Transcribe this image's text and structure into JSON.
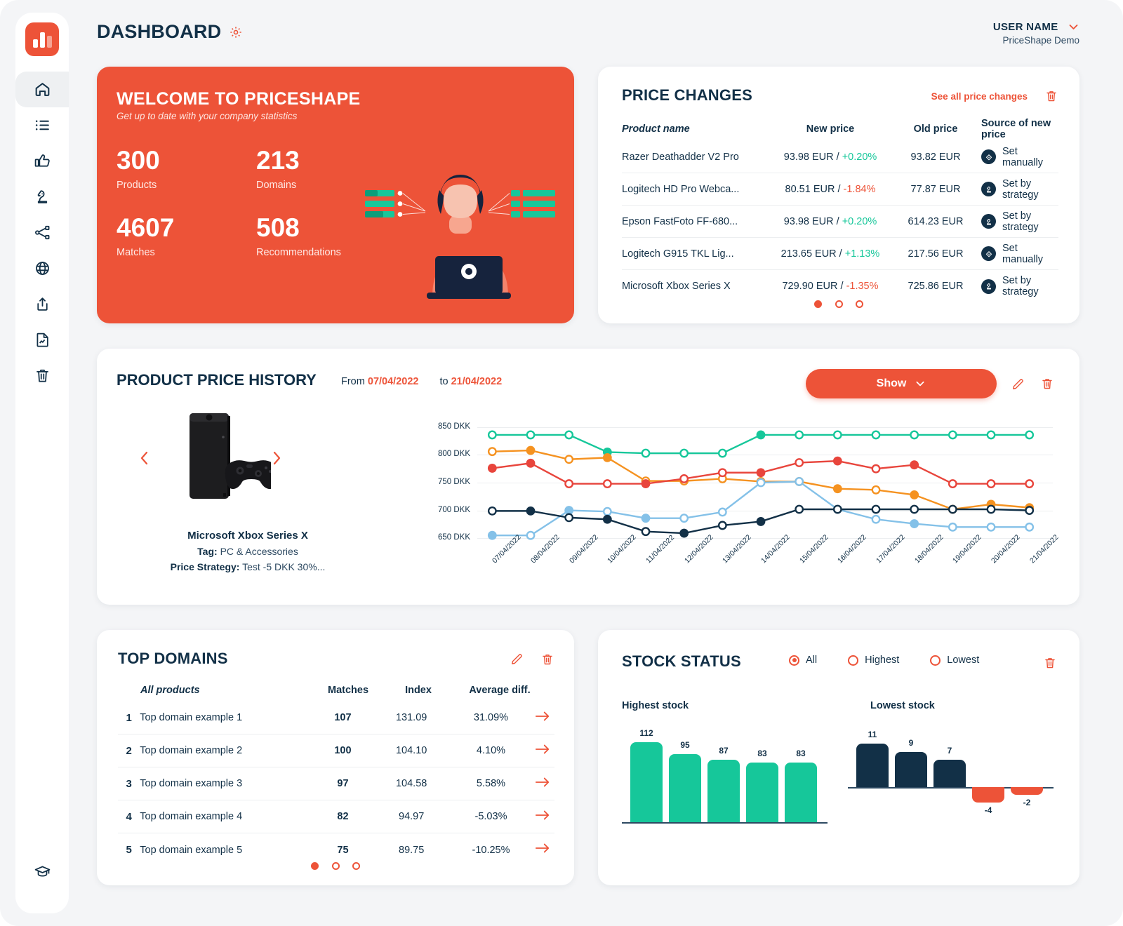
{
  "app": {
    "logo_icon": "bar-chart-logo",
    "page_title": "DASHBOARD",
    "settings_icon": "gear-icon"
  },
  "user": {
    "name": "USER NAME",
    "account": "PriceShape Demo",
    "caret_icon": "chevron-down-icon"
  },
  "sidebar": {
    "items": [
      {
        "name": "home",
        "icon": "home-icon",
        "active": true
      },
      {
        "name": "list",
        "icon": "list-icon",
        "active": false
      },
      {
        "name": "recommendations",
        "icon": "thumbs-up-icon",
        "active": false
      },
      {
        "name": "strategy",
        "icon": "chess-knight-icon",
        "active": false
      },
      {
        "name": "matches",
        "icon": "share-nodes-icon",
        "active": false
      },
      {
        "name": "domains",
        "icon": "globe-icon",
        "active": false
      },
      {
        "name": "export",
        "icon": "upload-box-icon",
        "active": false
      },
      {
        "name": "reports",
        "icon": "file-chart-icon",
        "active": false
      },
      {
        "name": "trash",
        "icon": "trash-icon",
        "active": false
      }
    ],
    "bottom_item": {
      "name": "academy",
      "icon": "graduation-cap-icon"
    }
  },
  "welcome": {
    "title": "WELCOME TO PRICESHAPE",
    "subtitle": "Get up to date with your company statistics",
    "stats": [
      {
        "value": "300",
        "label": "Products"
      },
      {
        "value": "213",
        "label": "Domains"
      },
      {
        "value": "4607",
        "label": "Matches"
      },
      {
        "value": "508",
        "label": "Recommendations"
      }
    ]
  },
  "price_changes": {
    "title": "PRICE CHANGES",
    "see_all_label": "See all price changes",
    "delete_icon": "trash-icon",
    "columns": [
      "Product name",
      "New price",
      "Old price",
      "Source of new price"
    ],
    "rows": [
      {
        "product": "Razer Deathadder V2 Pro",
        "new_price": "93.98 EUR / ",
        "change": "+0.20%",
        "direction": "up",
        "old_price": "93.82 EUR",
        "source": "Set manually",
        "source_icon": "tag-icon"
      },
      {
        "product": "Logitech HD Pro Webca...",
        "new_price": "80.51 EUR / ",
        "change": "-1.84%",
        "direction": "down",
        "old_price": "77.87 EUR",
        "source": "Set by strategy",
        "source_icon": "chess-knight-icon"
      },
      {
        "product": "Epson FastFoto FF-680...",
        "new_price": "93.98 EUR / ",
        "change": "+0.20%",
        "direction": "up",
        "old_price": "614.23 EUR",
        "source": "Set by strategy",
        "source_icon": "chess-knight-icon"
      },
      {
        "product": "Logitech G915 TKL Lig...",
        "new_price": "213.65 EUR / ",
        "change": "+1.13%",
        "direction": "up",
        "old_price": "217.56 EUR",
        "source": "Set manually",
        "source_icon": "tag-icon"
      },
      {
        "product": "Microsoft Xbox Series X",
        "new_price": "729.90 EUR / ",
        "change": "-1.35%",
        "direction": "down",
        "old_price": "725.86 EUR",
        "source": "Set by strategy",
        "source_icon": "chess-knight-icon"
      }
    ],
    "pagination": {
      "count": 3,
      "active": 0
    }
  },
  "price_history": {
    "title": "PRODUCT PRICE HISTORY",
    "from_label": "From",
    "from_date": "07/04/2022",
    "to_label": "to",
    "to_date": "21/04/2022",
    "show_button": "Show",
    "show_caret_icon": "chevron-down-icon",
    "edit_icon": "pencil-icon",
    "delete_icon": "trash-icon",
    "prev_icon": "chevron-left-icon",
    "next_icon": "chevron-right-icon",
    "product": {
      "image": "xbox-series-x-console",
      "name": "Microsoft Xbox Series X",
      "tag_label": "Tag:",
      "tag_value": "PC & Accessories",
      "strategy_label": "Price Strategy:",
      "strategy_value": "Test -5 DKK 30%..."
    }
  },
  "chart_data": {
    "type": "line",
    "title": "Product price history",
    "xlabel": "",
    "ylabel": "DKK",
    "ylim": [
      630,
      870
    ],
    "yticks": [
      650,
      700,
      750,
      800,
      850
    ],
    "ytick_labels": [
      "650 DKK",
      "700 DKK",
      "750 DKK",
      "800 DKK",
      "850 DKK"
    ],
    "grid": true,
    "legend": "none",
    "x": [
      "07/04/2022",
      "08/04/2022",
      "09/04/2022",
      "10/04/2022",
      "11/04/2022",
      "12/04/2022",
      "13/04/2022",
      "14/04/2022",
      "15/04/2022",
      "16/04/2022",
      "17/04/2022",
      "18/04/2022",
      "19/04/2022",
      "20/04/2022",
      "21/04/2022"
    ],
    "series": [
      {
        "name": "green",
        "color": "#16c79a",
        "values": [
          836,
          836,
          836,
          805,
          803,
          803,
          803,
          836,
          836,
          836,
          836,
          836,
          836,
          836,
          836
        ],
        "filled": [
          false,
          false,
          false,
          true,
          false,
          false,
          false,
          true,
          false,
          false,
          false,
          false,
          false,
          false,
          false
        ]
      },
      {
        "name": "orange",
        "color": "#f59220",
        "values": [
          806,
          808,
          792,
          795,
          753,
          753,
          757,
          752,
          752,
          739,
          737,
          728,
          702,
          711,
          705
        ],
        "filled": [
          false,
          true,
          false,
          true,
          false,
          false,
          false,
          false,
          false,
          true,
          false,
          true,
          true,
          true,
          true
        ]
      },
      {
        "name": "red",
        "color": "#e8453c",
        "values": [
          776,
          785,
          748,
          748,
          748,
          757,
          768,
          768,
          786,
          789,
          775,
          782,
          748,
          748,
          748
        ],
        "filled": [
          true,
          true,
          false,
          false,
          true,
          false,
          false,
          true,
          false,
          true,
          false,
          true,
          false,
          false,
          false
        ]
      },
      {
        "name": "lightblue",
        "color": "#84c1e8",
        "values": [
          655,
          655,
          700,
          698,
          686,
          686,
          697,
          750,
          752,
          702,
          684,
          676,
          670,
          670,
          670
        ],
        "filled": [
          true,
          false,
          true,
          false,
          true,
          false,
          false,
          false,
          false,
          true,
          false,
          true,
          false,
          false,
          false
        ]
      },
      {
        "name": "navy",
        "color": "#123047",
        "values": [
          699,
          699,
          687,
          684,
          662,
          659,
          673,
          680,
          702,
          702,
          702,
          702,
          702,
          702,
          700
        ],
        "filled": [
          false,
          true,
          false,
          true,
          false,
          true,
          false,
          true,
          false,
          false,
          false,
          false,
          false,
          false,
          false
        ]
      }
    ]
  },
  "top_domains": {
    "title": "TOP DOMAINS",
    "edit_icon": "pencil-icon",
    "delete_icon": "trash-icon",
    "columns": [
      "All products",
      "Matches",
      "Index",
      "Average diff."
    ],
    "rows": [
      {
        "rank": "1",
        "name": "Top domain example 1",
        "matches": "107",
        "index": "131.09",
        "diff": "31.09%",
        "arrow_icon": "arrow-right-icon"
      },
      {
        "rank": "2",
        "name": "Top domain example 2",
        "matches": "100",
        "index": "104.10",
        "diff": "4.10%",
        "arrow_icon": "arrow-right-icon"
      },
      {
        "rank": "3",
        "name": "Top domain example 3",
        "matches": "97",
        "index": "104.58",
        "diff": "5.58%",
        "arrow_icon": "arrow-right-icon"
      },
      {
        "rank": "4",
        "name": "Top domain example 4",
        "matches": "82",
        "index": "94.97",
        "diff": "-5.03%",
        "arrow_icon": "arrow-right-icon"
      },
      {
        "rank": "5",
        "name": "Top domain example 5",
        "matches": "75",
        "index": "89.75",
        "diff": "-10.25%",
        "arrow_icon": "arrow-right-icon"
      }
    ],
    "pagination": {
      "count": 3,
      "active": 0
    }
  },
  "stock_status": {
    "title": "STOCK STATUS",
    "delete_icon": "trash-icon",
    "filters": [
      {
        "label": "All",
        "selected": true
      },
      {
        "label": "Highest",
        "selected": false
      },
      {
        "label": "Lowest",
        "selected": false
      }
    ],
    "highest_label": "Highest stock",
    "lowest_label": "Lowest stock",
    "highest_chart": {
      "type": "bar",
      "title": "Highest stock",
      "values": [
        112,
        95,
        87,
        83,
        83
      ],
      "color": "#16c79a",
      "ylim": [
        0,
        120
      ]
    },
    "lowest_chart": {
      "type": "bar",
      "title": "Lowest stock",
      "values": [
        11,
        9,
        7,
        -4,
        -2
      ],
      "positive_color": "#123047",
      "negative_color": "#ed5338",
      "ylim": [
        -6,
        13
      ]
    }
  }
}
